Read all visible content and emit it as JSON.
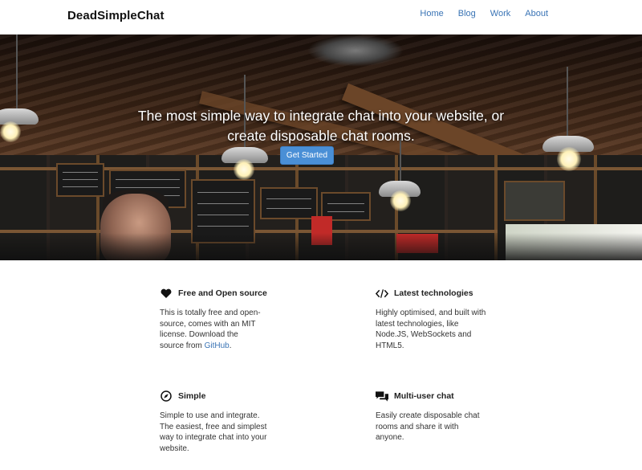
{
  "navbar": {
    "brand": "DeadSimpleChat",
    "links": [
      "Home",
      "Blog",
      "Work",
      "About"
    ]
  },
  "hero": {
    "headline_line1": "The most simple way to integrate chat into your website, or",
    "headline_line2": "create disposable chat rooms.",
    "cta_label": "Get Started",
    "cta_color": "#4a8fd6"
  },
  "features": [
    {
      "icon": "heart-icon",
      "title": "Free and Open source",
      "desc_before": "This is totally free and open-source, comes with an MIT license. Download the source from ",
      "desc_link": "GitHub",
      "desc_after": "."
    },
    {
      "icon": "code-icon",
      "title": "Latest technologies",
      "desc": "Highly optimised, and built with latest technologies, like Node.JS, WebSockets and HTML5."
    },
    {
      "icon": "compass-icon",
      "title": "Simple",
      "desc": "Simple to use and integrate. The easiest, free and simplest way to integrate chat into your website."
    },
    {
      "icon": "chat-bubbles-icon",
      "title": "Multi-user chat",
      "desc": "Easily create disposable chat rooms and share it with anyone."
    }
  ],
  "colors": {
    "link": "#3a74b5",
    "text": "#333333"
  }
}
